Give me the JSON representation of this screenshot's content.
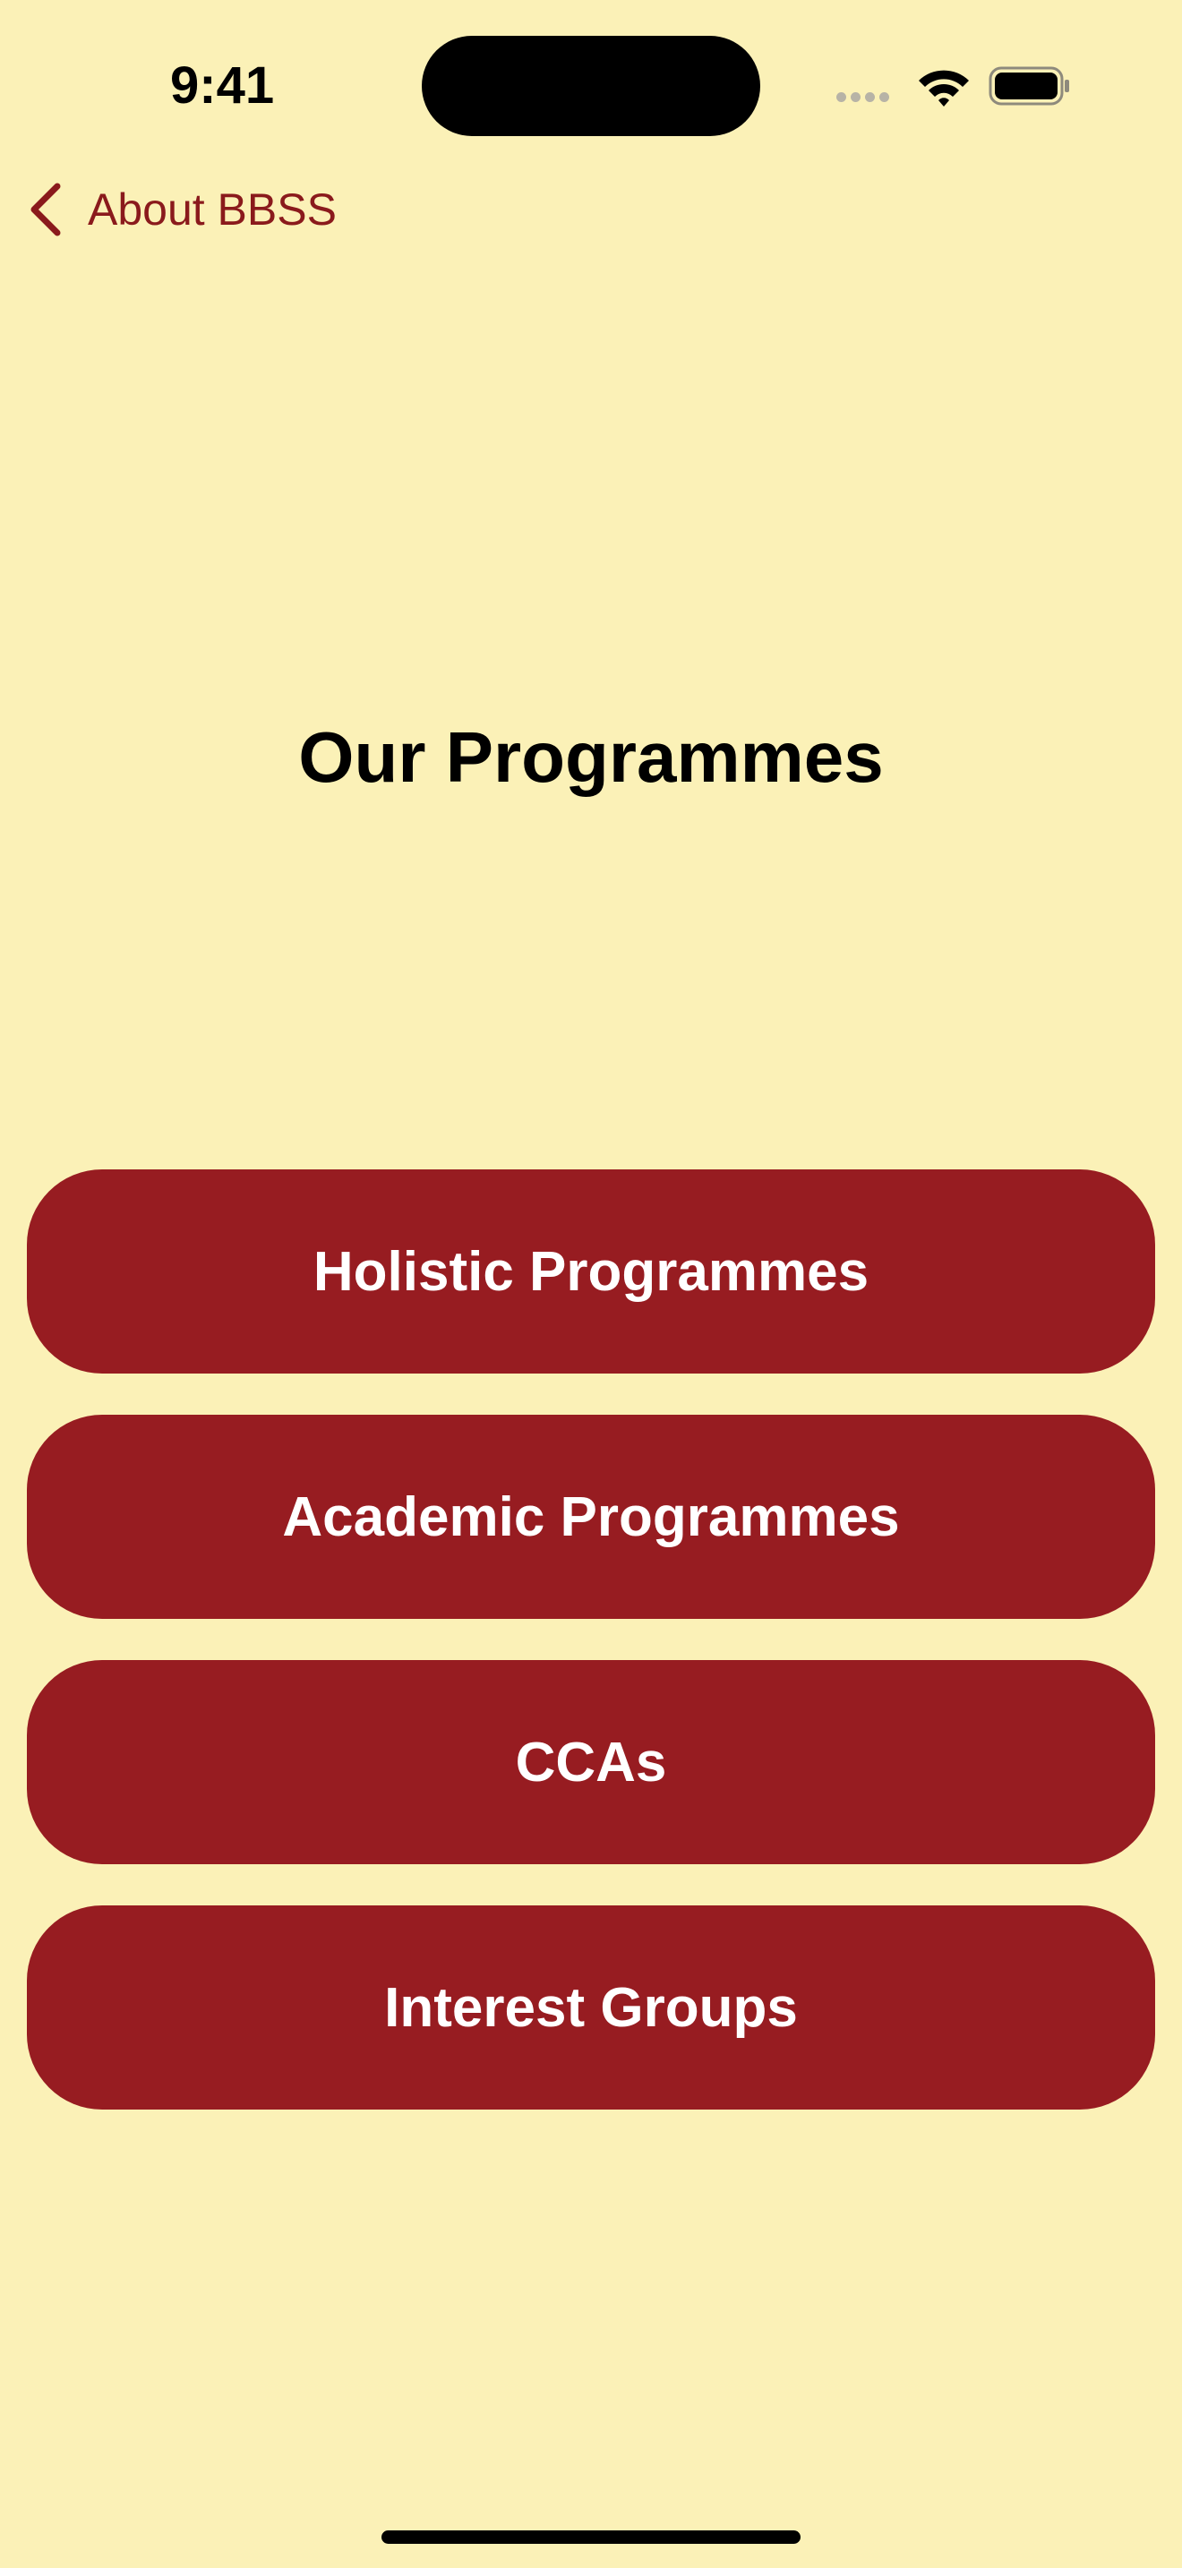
{
  "status_bar": {
    "time": "9:41",
    "icons": [
      "cellular-signal-icon",
      "wifi-icon",
      "battery-icon"
    ]
  },
  "nav": {
    "back_label": "About BBSS",
    "back_icon": "chevron-left-icon"
  },
  "page": {
    "title": "Our Programmes"
  },
  "menu": {
    "items": [
      {
        "label": "Holistic Programmes"
      },
      {
        "label": "Academic Programmes"
      },
      {
        "label": "CCAs"
      },
      {
        "label": "Interest Groups"
      }
    ]
  },
  "colors": {
    "background": "#FBF1B7",
    "accent": "#971C21",
    "back_text": "#8A1A1C",
    "button_text": "#FFFFFF"
  }
}
